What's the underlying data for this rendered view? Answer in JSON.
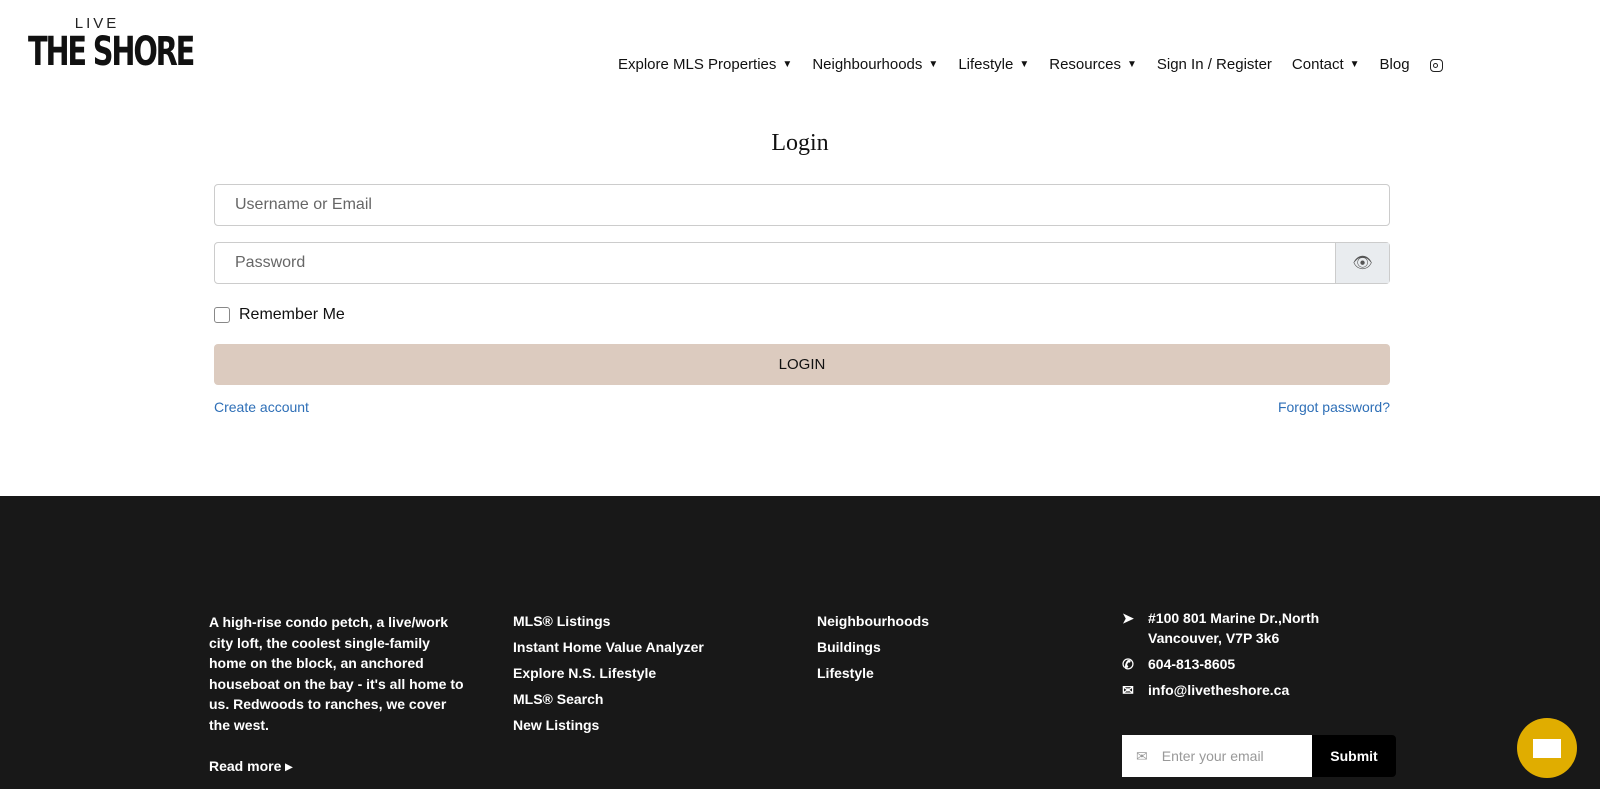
{
  "logo": {
    "top": "LIVE",
    "main": "THE SHORE"
  },
  "nav": [
    "Explore MLS Properties",
    "Neighbourhoods",
    "Lifestyle",
    "Resources",
    "Sign In / Register",
    "Contact",
    "Blog"
  ],
  "login": {
    "title": "Login",
    "username_placeholder": "Username or Email",
    "password_placeholder": "Password",
    "remember": "Remember Me",
    "button": "LOGIN",
    "create": "Create account",
    "forgot": "Forgot password?"
  },
  "footer": {
    "about": "A high-rise condo petch, a live/work city loft, the coolest single-family home on the block, an anchored houseboat on the bay - it's all home to us. Redwoods to ranches, we cover the west.",
    "read_more": "Read more",
    "links1": [
      "MLS® Listings",
      "Instant Home Value Analyzer",
      "Explore N.S. Lifestyle",
      "MLS® Search",
      "New Listings"
    ],
    "links2": [
      "Neighbourhoods",
      "Buildings",
      "Lifestyle"
    ],
    "address": "#100 801 Marine Dr.,North Vancouver, V7P 3k6",
    "phone": "604-813-8605",
    "email": "info@livetheshore.ca",
    "email_placeholder": "Enter your email",
    "submit": "Submit"
  }
}
